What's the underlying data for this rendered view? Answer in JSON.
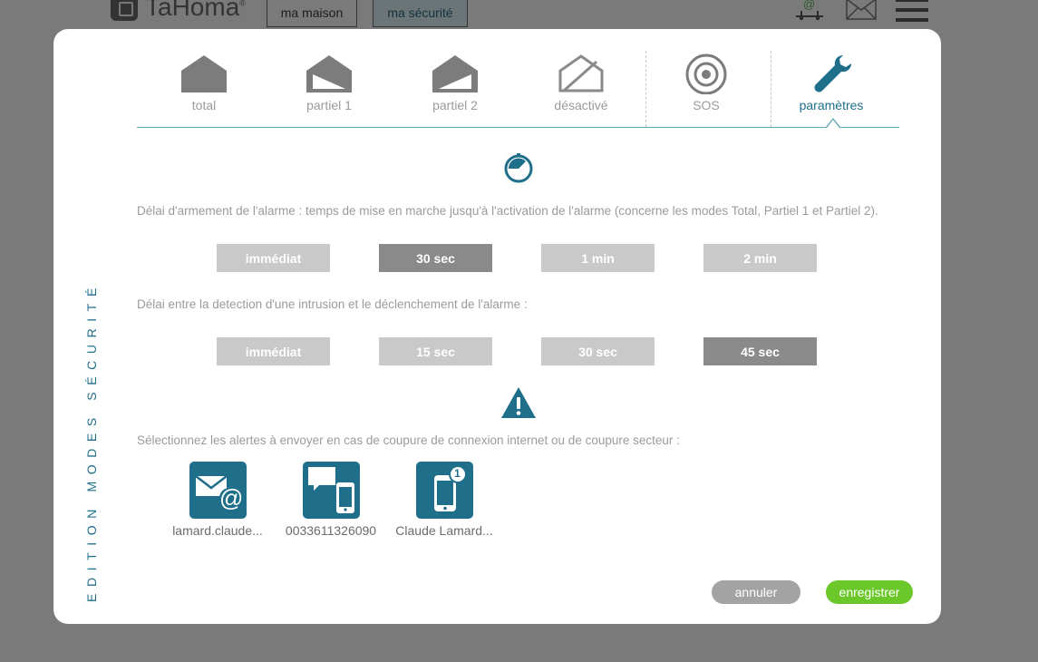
{
  "app": {
    "logo_text": "TaHoma",
    "logo_mark": "®"
  },
  "nav_tabs": [
    {
      "label": "ma maison"
    },
    {
      "label": "ma sécurité"
    }
  ],
  "header_icons": [
    "at-network-icon",
    "mail-icon",
    "menu-icon"
  ],
  "modal": {
    "vertical_title": "EDITION MODES SÉCURITÉ",
    "modes": [
      {
        "label": "total",
        "icon": "house-full-icon"
      },
      {
        "label": "partiel 1",
        "icon": "house-partial-1-icon"
      },
      {
        "label": "partiel 2",
        "icon": "house-partial-2-icon"
      },
      {
        "label": "désactivé",
        "icon": "house-off-icon"
      },
      {
        "label": "SOS",
        "icon": "sos-target-icon"
      },
      {
        "label": "paramètres",
        "icon": "wrench-icon",
        "active": true
      }
    ],
    "arming": {
      "description": "Délai d'armement de l'alarme : temps de mise en marche jusqu'à l'activation de l'alarme (concerne les modes Total, Partiel 1 et Partiel 2).",
      "options": [
        "immédiat",
        "30 sec",
        "1 min",
        "2 min"
      ],
      "selected": "30 sec"
    },
    "intrusion": {
      "description": "Délai entre la detection d'une intrusion et le déclenchement de l'alarme :",
      "options": [
        "immédiat",
        "15 sec",
        "30 sec",
        "45 sec"
      ],
      "selected": "45 sec"
    },
    "alerts": {
      "description": "Sélectionnez les alertes à envoyer en cas de coupure de connexion internet ou de coupure secteur :",
      "items": [
        {
          "caption": "lamard.claude...",
          "icon": "email-at-icon"
        },
        {
          "caption": "0033611326090",
          "icon": "sms-phone-icon"
        },
        {
          "caption": "Claude Lamard...",
          "icon": "push-notification-icon",
          "badge": "1"
        }
      ]
    },
    "buttons": {
      "cancel": "annuler",
      "save": "enregistrer"
    }
  },
  "colors": {
    "accent": "#1f6f8b",
    "selected": "#8a8a8a",
    "unselected": "#c9c9c9",
    "save": "#6cc72b",
    "cancel": "#a3a3a3"
  }
}
